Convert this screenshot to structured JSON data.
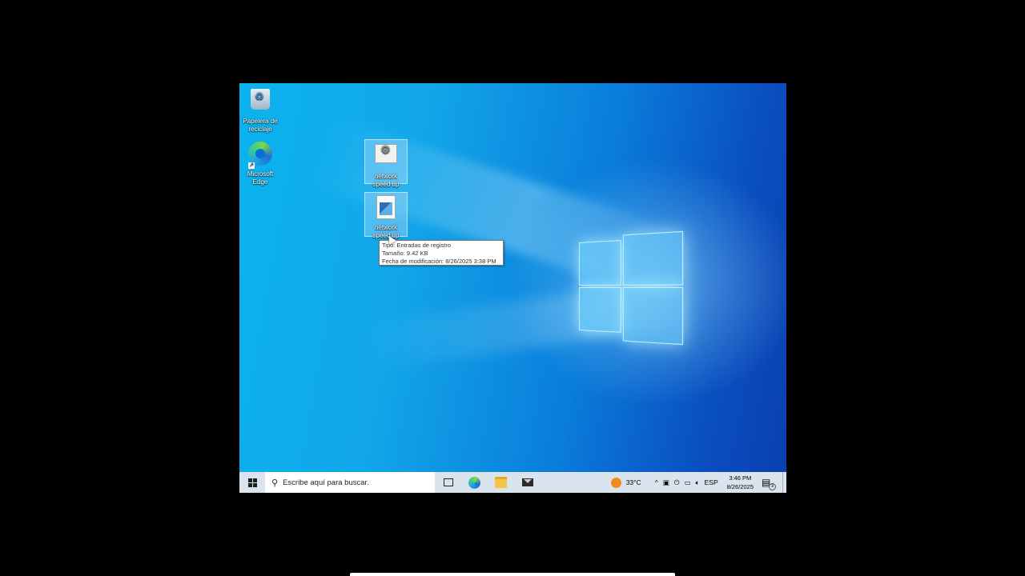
{
  "desktop": {
    "icons": [
      {
        "label": "Papelera de reciclaje",
        "icon": "recycle-bin-icon"
      },
      {
        "label": "Microsoft Edge",
        "icon": "edge-icon"
      },
      {
        "label": "network speed up",
        "icon": "settings-file-icon"
      },
      {
        "label": "network speed up",
        "icon": "registry-file-icon"
      }
    ],
    "tooltip": {
      "line1": "Tipo: Entradas de registro",
      "line2": "Tamaño: 9.42 KB",
      "line3": "Fecha de modificación: 8/26/2025 3:38 PM"
    }
  },
  "taskbar": {
    "search_placeholder": "Escribe aquí para buscar.",
    "weather_temp": "33°C",
    "language": "ESP",
    "time": "3:46 PM",
    "date": "8/26/2025",
    "notification_count": "3"
  }
}
